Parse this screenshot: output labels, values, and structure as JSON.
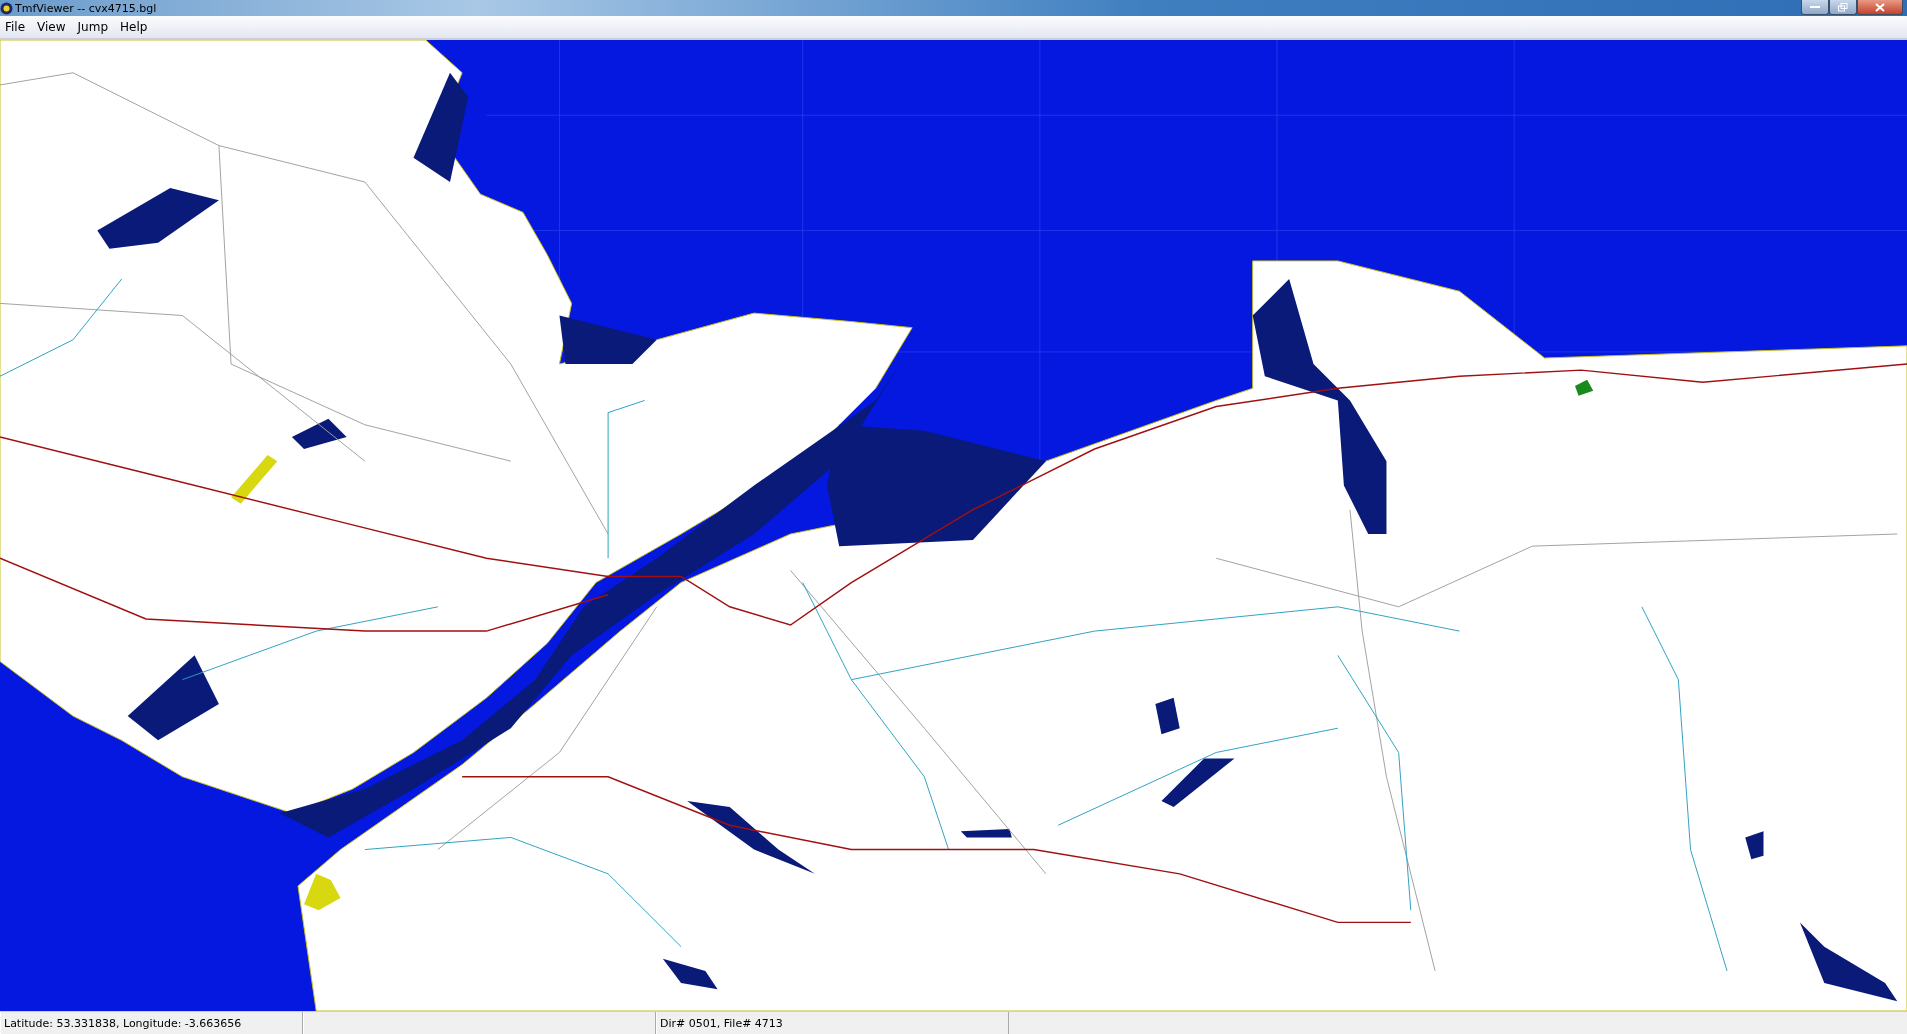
{
  "window": {
    "title": "TmfViewer -- cvx4715.bgl"
  },
  "menu": [
    "File",
    "View",
    "Jump",
    "Help"
  ],
  "status_bar": {
    "position": "Latitude: 53.331838, Longitude: -3.663656",
    "file": "Dir# 0501, File# 4713"
  }
}
